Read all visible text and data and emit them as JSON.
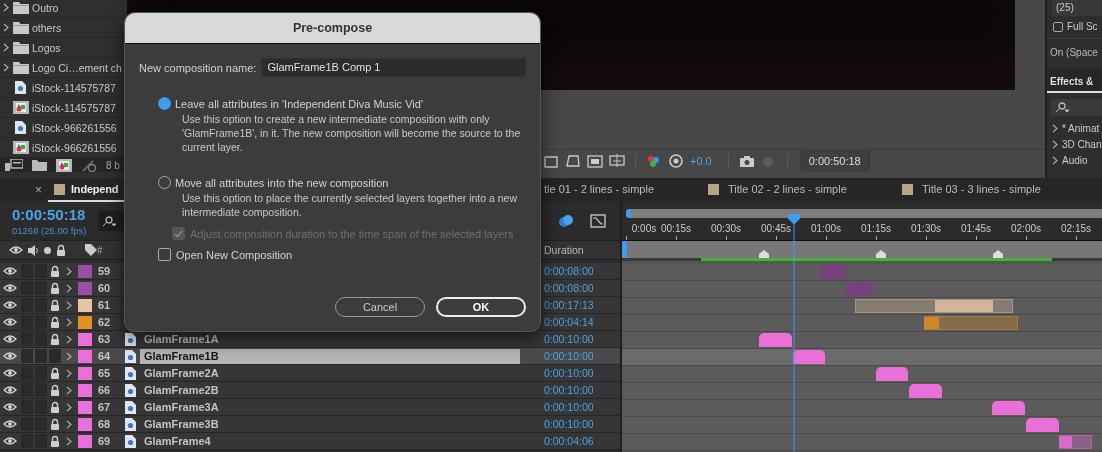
{
  "project_panel": {
    "items": [
      {
        "kind": "folder",
        "name": "Outro"
      },
      {
        "kind": "folder",
        "name": "others"
      },
      {
        "kind": "folder",
        "name": "Logos"
      },
      {
        "kind": "folder",
        "name": "Logo Ci…ement ch"
      },
      {
        "kind": "still",
        "name": "iStock-114575787"
      },
      {
        "kind": "sequence",
        "name": "iStock-114575787"
      },
      {
        "kind": "still",
        "name": "iStock-966261556"
      },
      {
        "kind": "sequence",
        "name": "iStock-966261556"
      }
    ],
    "bit_depth": "8 b"
  },
  "viewer": {
    "exposure": "+0.0",
    "current_time": "0:00:50:18"
  },
  "side_panel": {
    "resolution": "(25)",
    "full_screen": {
      "label": "Full Sc",
      "checked": false
    },
    "shortcut": "On (Space",
    "tab": "Effects &",
    "categories": [
      "* Animat",
      "3D Chan",
      "Audio"
    ]
  },
  "timeline": {
    "close_glyph": "×",
    "tabs": [
      {
        "label": "Independ",
        "selected": true,
        "color": "#b7a585"
      },
      {
        "label": "tle 01 - 2 lines - simple",
        "selected": false
      },
      {
        "label": "Title 02 - 2 lines - simple",
        "selected": false,
        "color": "#b7a585"
      },
      {
        "label": "Title 03 - 3 lines - simple",
        "selected": false,
        "color": "#b7a585"
      }
    ],
    "current_time": "0:00:50:18",
    "frame_info": "01268 (25.00 fps)",
    "columns": {
      "number": "#",
      "duration": "Duration"
    },
    "ruler": [
      "0:00s",
      "00:15s",
      "00:30s",
      "00:45s",
      "01:00s",
      "01:15s",
      "01:30s",
      "01:45s",
      "02:00s",
      "02:15s"
    ],
    "rows": [
      {
        "number": "59",
        "color": "#9b4ea6",
        "duration": "0:00:08:00",
        "selected": false,
        "locked": true
      },
      {
        "number": "60",
        "color": "#9b4ea6",
        "duration": "0:00:08:00",
        "selected": false,
        "locked": true
      },
      {
        "number": "61",
        "color": "#e7c4a2",
        "duration": "0:00:17:13",
        "selected": false,
        "locked": true
      },
      {
        "number": "62",
        "color": "#e58f22",
        "duration": "0:00:04:14",
        "selected": false,
        "locked": true
      },
      {
        "number": "63",
        "color": "#ea6fd8",
        "name": "GlamFrame1A",
        "duration": "0:00:10:00",
        "selected": false,
        "locked": true
      },
      {
        "number": "64",
        "color": "#ea6fd8",
        "name": "GlamFrame1B",
        "duration": "0:00:10:00",
        "selected": true,
        "locked": false
      },
      {
        "number": "65",
        "color": "#ea6fd8",
        "name": "GlamFrame2A",
        "duration": "0:00:10:00",
        "selected": false,
        "locked": true
      },
      {
        "number": "66",
        "color": "#ea6fd8",
        "name": "GlamFrame2B",
        "duration": "0:00:10:00",
        "selected": false,
        "locked": true
      },
      {
        "number": "67",
        "color": "#ea6fd8",
        "name": "GlamFrame3A",
        "duration": "0:00:10:00",
        "selected": false,
        "locked": true
      },
      {
        "number": "68",
        "color": "#ea6fd8",
        "name": "GlamFrame3B",
        "duration": "0:00:10:00",
        "selected": false,
        "locked": true
      },
      {
        "number": "69",
        "color": "#ea6fd8",
        "name": "GlamFrame4",
        "duration": "0:00:04:06",
        "selected": false,
        "locked": true
      }
    ]
  },
  "dialog": {
    "title": "Pre-compose",
    "name_label": "New composition name:",
    "name_value": "GlamFrame1B Comp 1",
    "options": [
      {
        "label": "Leave all attributes in 'Independent Diva Music Vid'",
        "description": "Use this option to create a new intermediate composition with only 'GlamFrame1B', in it. The new composition will become the source to the current layer.",
        "selected": true
      },
      {
        "label": "Move all attributes into the new composition",
        "description": "Use this option to place the currently selected layers together into a new intermediate composition.",
        "selected": false
      }
    ],
    "adjust_duration": {
      "label": "Adjust composition duration to the time span of the selected layers",
      "checked": true,
      "disabled": true
    },
    "open_new": {
      "label": "Open New Composition",
      "checked": false,
      "disabled": false
    },
    "buttons": [
      {
        "label": "Cancel",
        "default": false
      },
      {
        "label": "OK",
        "default": true
      }
    ]
  }
}
